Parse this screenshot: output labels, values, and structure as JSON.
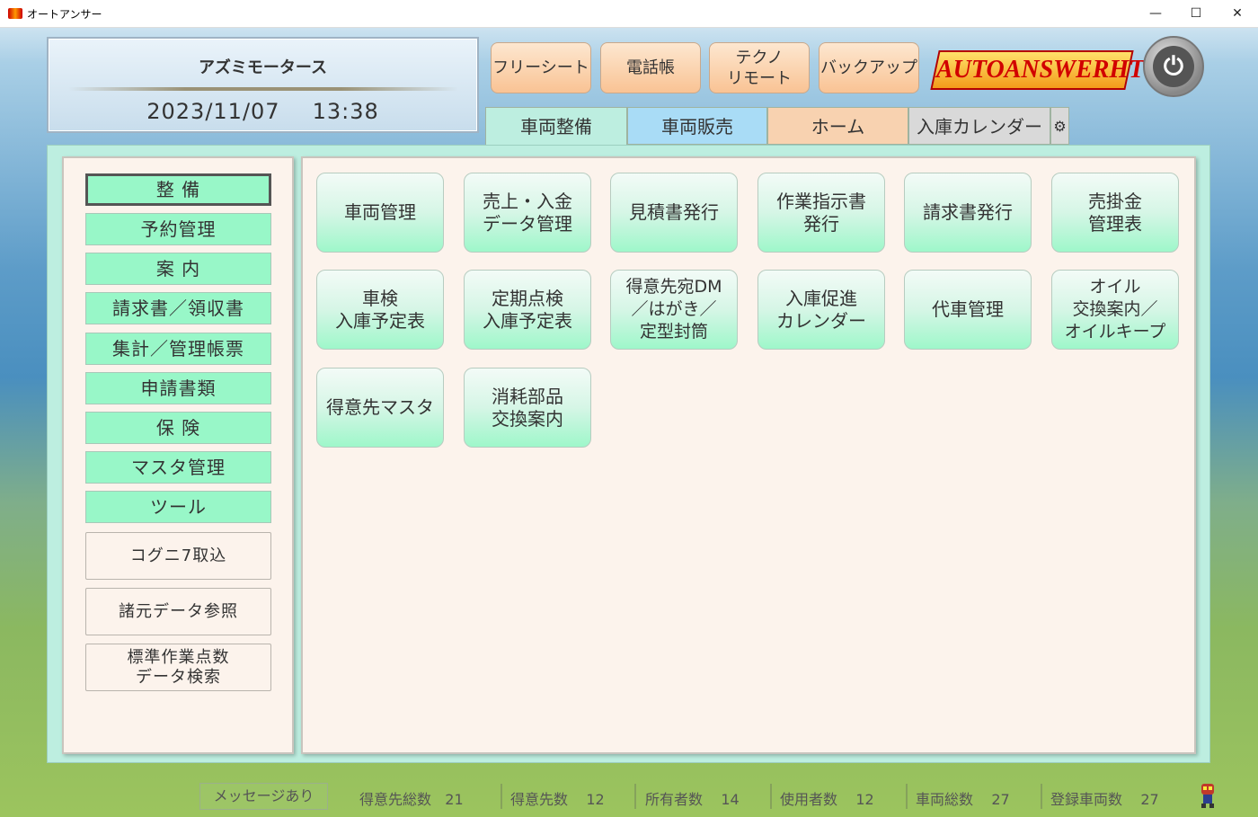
{
  "window": {
    "title": "オートアンサー",
    "minimize": "—",
    "maximize": "☐",
    "close": "✕"
  },
  "header": {
    "company": "アズミモータース",
    "date": "2023/11/07",
    "time": "13:38"
  },
  "top_buttons": [
    "フリーシート",
    "電話帳",
    "テクノ\nリモート",
    "バックアップ"
  ],
  "logo_text": "AUTOANSWERHT",
  "power_icon": "⏻",
  "tabs": [
    {
      "label": "車両整備",
      "color": "#bdeee0"
    },
    {
      "label": "車両販売",
      "color": "#a9dcf6"
    },
    {
      "label": "ホーム",
      "color": "#f8d2b0"
    },
    {
      "label": "入庫カレンダー",
      "color": "#d9d9d9"
    }
  ],
  "settings_icon": "⚙",
  "sidebar": {
    "items": [
      "整 備",
      "予約管理",
      "案 内",
      "請求書／領収書",
      "集計／管理帳票",
      "申請書類",
      "保 険",
      "マスタ管理",
      "ツール"
    ],
    "plain_items": [
      "コグニ7取込",
      "諸元データ参照",
      "標準作業点数\nデータ検索"
    ]
  },
  "cards": [
    "車両管理",
    "売上・入金\nデータ管理",
    "見積書発行",
    "作業指示書\n発行",
    "請求書発行",
    "売掛金\n管理表",
    "車検\n入庫予定表",
    "定期点検\n入庫予定表",
    "得意先宛DM\n／はがき／\n定型封筒",
    "入庫促進\nカレンダー",
    "代車管理",
    "オイル\n交換案内／\nオイルキープ",
    "得意先マスタ",
    "消耗部品\n交換案内"
  ],
  "status": {
    "message": "メッセージあり",
    "stats": [
      {
        "label": "得意先総数",
        "value": "21"
      },
      {
        "label": "得意先数",
        "value": "12"
      },
      {
        "label": "所有者数",
        "value": "14"
      },
      {
        "label": "使用者数",
        "value": "12"
      },
      {
        "label": "車両総数",
        "value": "27"
      },
      {
        "label": "登録車両数",
        "value": "27"
      }
    ]
  }
}
